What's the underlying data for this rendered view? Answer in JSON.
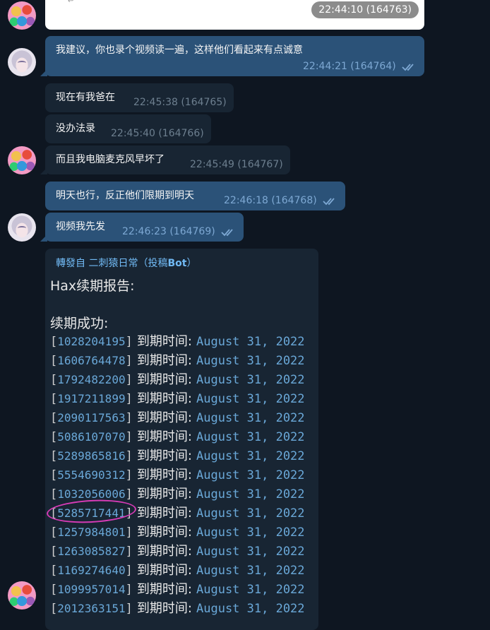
{
  "top_image": {
    "time": "22:44:10 (164763)",
    "hidden_text": "164763"
  },
  "messages": [
    {
      "text": "我建议，你也录个视频读一遍，这样他们看起来有点诚意",
      "meta": "22:44:21 (164764)"
    },
    {
      "text": "现在有我爸在",
      "meta": "22:45:38 (164765)"
    },
    {
      "text": "没办法录",
      "meta": "22:45:40 (164766)"
    },
    {
      "text": "而且我电脑麦克风早坏了",
      "meta": "22:45:49 (164767)"
    },
    {
      "text": "明天也行，反正他们限期到明天",
      "meta": "22:46:18 (164768)"
    },
    {
      "text": "视频我先发",
      "meta": "22:46:23 (164769)"
    }
  ],
  "forward": {
    "prefix": "轉發自 二刺猿日常（投稿",
    "bot": "Bot",
    "suffix": "）",
    "title": "Hax续期报告:",
    "subtitle": "续期成功:",
    "label": "到期时间:",
    "date": "August 31, 2022",
    "ids": [
      "1028204195",
      "1606764478",
      "1792482200",
      "1917211899",
      "2090117563",
      "5086107070",
      "5289865816",
      "5554690312",
      "1032056006",
      "5285717441",
      "1257984801",
      "1263085827",
      "1169274640",
      "1099957014",
      "2012363151"
    ]
  },
  "colors": {
    "background": "#0e1621",
    "incoming": "#182533",
    "outgoing": "#2b5278",
    "link": "#71baf5",
    "highlight_circle": "#d63bb6"
  }
}
